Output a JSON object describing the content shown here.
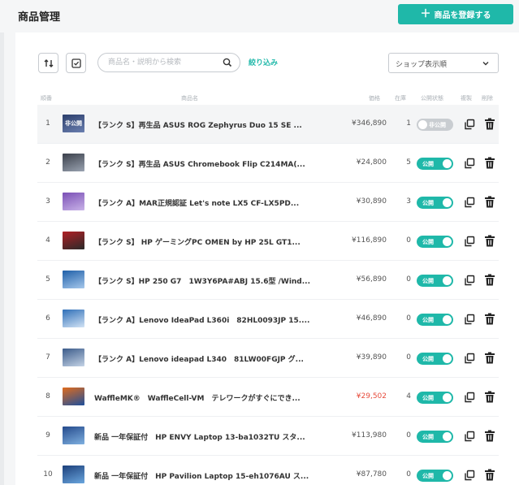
{
  "header": {
    "title": "商品管理",
    "add_button": "商品を登録する"
  },
  "toolbar": {
    "search_placeholder": "商品名・説明から検索",
    "filter_label": "絞り込み",
    "sort_select": "ショップ表示順"
  },
  "columns": {
    "order": "順番",
    "name": "商品名",
    "price": "価格",
    "stock": "在庫",
    "status": "公開状態",
    "copy": "複製",
    "delete": "削除"
  },
  "toggle_labels": {
    "on": "公開",
    "off": "非公開"
  },
  "products": [
    {
      "order": "1",
      "name": "【ランク S】再生品 ASUS ROG Zephyrus Duo 15 SE ...",
      "price": "¥346,890",
      "stock": "1",
      "published": false,
      "thumb_label": "非公開"
    },
    {
      "order": "2",
      "name": "【ランク S】再生品 ASUS Chromebook Flip C214MA(...",
      "price": "¥24,800",
      "stock": "5",
      "published": true
    },
    {
      "order": "3",
      "name": "【ランク A】MAR正規認証 Let's note LX5 CF-LX5PD...",
      "price": "¥30,890",
      "stock": "3",
      "published": true
    },
    {
      "order": "4",
      "name": "【ランク S】 HP ゲーミングPC OMEN by HP 25L GT1...",
      "price": "¥116,890",
      "stock": "0",
      "published": true
    },
    {
      "order": "5",
      "name": "【ランク S】HP 250 G7　1W3Y6PA#ABJ 15.6型 /Wind...",
      "price": "¥56,890",
      "stock": "0",
      "published": true
    },
    {
      "order": "6",
      "name": "【ランク A】Lenovo IdeaPad L360i　82HL0093JP 15....",
      "price": "¥46,890",
      "stock": "0",
      "published": true
    },
    {
      "order": "7",
      "name": "【ランク A】Lenovo ideapad L340　81LW00FGJP グ...",
      "price": "¥39,890",
      "stock": "0",
      "published": true
    },
    {
      "order": "8",
      "name": "WaffleMK®　WaffleCell-VM　テレワークがすぐにでき...",
      "price": "¥29,502",
      "stock": "4",
      "published": true,
      "price_highlight": true
    },
    {
      "order": "9",
      "name": "新品 一年保証付　HP ENVY Laptop 13-ba1032TU スタ...",
      "price": "¥113,980",
      "stock": "0",
      "published": true
    },
    {
      "order": "10",
      "name": "新品 一年保証付　HP Pavilion Laptop 15-eh1076AU ス...",
      "price": "¥87,780",
      "stock": "0",
      "published": true
    }
  ],
  "colors": {
    "accent": "#1fb8a9",
    "toggle_off": "#c9cdd1",
    "price_highlight": "#e74c3c"
  }
}
